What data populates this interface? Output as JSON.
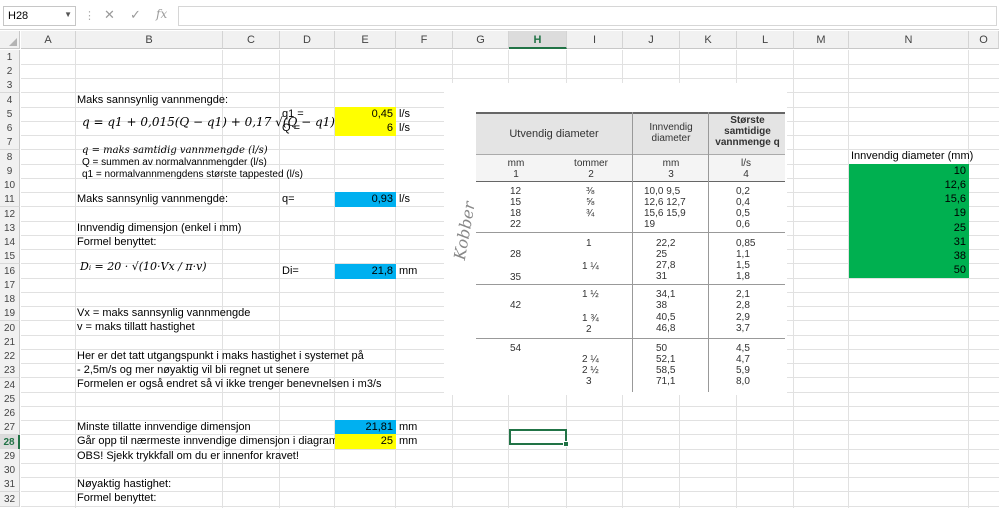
{
  "formula_bar": {
    "name_box": "H28",
    "fx_label": "fx",
    "content": ""
  },
  "columns": [
    "A",
    "B",
    "C",
    "D",
    "E",
    "F",
    "G",
    "H",
    "I",
    "J",
    "K",
    "L",
    "M",
    "N",
    "O"
  ],
  "rows": [
    "1",
    "2",
    "3",
    "4",
    "5",
    "6",
    "7",
    "8",
    "9",
    "10",
    "11",
    "12",
    "13",
    "14",
    "15",
    "16",
    "17",
    "18",
    "19",
    "20",
    "21",
    "22",
    "23",
    "24",
    "25",
    "26",
    "27",
    "28",
    "29",
    "30",
    "31",
    "32"
  ],
  "sheet": {
    "b4": "Maks sannsynlig vannmengde:",
    "formula_q": "q = q1 + 0,015(Q − q1) + 0,17 √(Q − q1)",
    "def_q": "q = maks samtidig vannmengde (l/s)",
    "def_Q": "Q = summen av normalvannmengder (l/s)",
    "def_q1": "q1 = normalvannmengdens største tappested (l/s)",
    "d5": "q1 =",
    "e5": "0,45",
    "f5": "l/s",
    "d6": "Q =",
    "e6": "6",
    "f6": "l/s",
    "b11": "Maks sannsynlig vannmengde:",
    "d11": "q=",
    "e11": "0,93",
    "f11": "l/s",
    "b13": "Innvendig dimensjon (enkel i mm)",
    "b14": "Formel benyttet:",
    "formula_di": "Dᵢ = 20 · √(10·Vx / π·v)",
    "d16": "Di=",
    "e16": "21,8",
    "f16": "mm",
    "b19": "Vx = maks sannsynlig vannmengde",
    "b20": "v = maks tillatt hastighet",
    "b22": "Her er det tatt utgangspunkt i maks hastighet i systemet på",
    "b23": "- 2,5m/s og mer nøyaktig vil bli regnet ut senere",
    "b24": "Formelen er også endret så vi ikke trenger benevnelsen i m3/s",
    "b27": "Minste tillatte innvendige dimensjon",
    "e27": "21,81",
    "f27": "mm",
    "b28": "Går opp til nærmeste innvendige dimensjon i diagrammet",
    "e28": "25",
    "f28": "mm",
    "b29": "OBS! Sjekk trykkfall om du er innenfor kravet!",
    "b31": "Nøyaktig hastighet:",
    "b32": "Formel benyttet:",
    "n8": "Innvendig diameter (mm)",
    "n_values": [
      "10",
      "12,6",
      "15,6",
      "19",
      "25",
      "31",
      "38",
      "50"
    ]
  },
  "picture_table": {
    "headers": [
      "Utvendig diameter",
      "Innvendig diameter",
      "Største samtidige vannmenge q"
    ],
    "units": [
      "mm",
      "tommer",
      "mm",
      "l/s"
    ],
    "col_numbers": [
      "1",
      "2",
      "3",
      "4"
    ],
    "groups": [
      {
        "mm": [
          "12",
          "15",
          "18",
          "22"
        ],
        "tommer": [
          "⅜",
          "⅝",
          "¾",
          ""
        ],
        "inner": [
          "10,0  9,5",
          "12,6  12,7",
          "15,6  15,9",
          "19"
        ],
        "q": [
          "0,2",
          "0,4",
          "0,5",
          "0,6"
        ]
      },
      {
        "mm": [
          "",
          "28",
          "",
          "35"
        ],
        "tommer": [
          "1",
          "",
          "1 ¼",
          ""
        ],
        "inner": [
          "22,2",
          "25",
          "27,8",
          "31"
        ],
        "q": [
          "0,85",
          "1,1",
          "1,5",
          "1,8"
        ]
      },
      {
        "mm": [
          "",
          "42",
          "",
          ""
        ],
        "tommer": [
          "1 ½",
          "",
          "1 ¾",
          "2"
        ],
        "inner": [
          "34,1",
          "38",
          "40,5",
          "46,8"
        ],
        "q": [
          "2,1",
          "2,8",
          "2,9",
          "3,7"
        ]
      },
      {
        "mm": [
          "54",
          "",
          "",
          ""
        ],
        "tommer": [
          "",
          "2 ¼",
          "2 ½",
          "3"
        ],
        "inner": [
          "50",
          "52,1",
          "58,5",
          "71,1"
        ],
        "q": [
          "4,5",
          "4,7",
          "5,9",
          "8,0"
        ]
      }
    ],
    "handwritten": "Kobber"
  }
}
